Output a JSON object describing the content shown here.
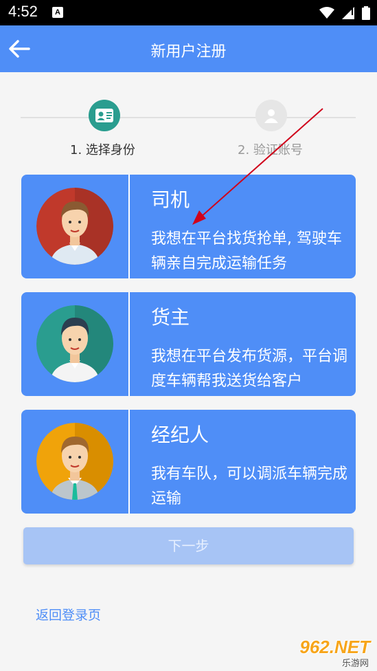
{
  "status_bar": {
    "time": "4:52",
    "notification_icon": "A"
  },
  "app_bar": {
    "title": "新用户注册",
    "back_icon": "arrow-left-icon"
  },
  "stepper": {
    "steps": [
      {
        "label": "1. 选择身份",
        "active": true,
        "icon": "id-card-icon"
      },
      {
        "label": "2. 验证账号",
        "active": false,
        "icon": "user-icon"
      }
    ]
  },
  "roles": [
    {
      "title": "司机",
      "description": "我想在平台找货抢单, 驾驶车辆亲自完成运输任务",
      "avatar_color": "#c0392b"
    },
    {
      "title": "货主",
      "description": "我想在平台发布货源，平台调度车辆帮我送货给客户",
      "avatar_color": "#2a9d8f"
    },
    {
      "title": "经纪人",
      "description": "我有车队，可以调派车辆完成运输",
      "avatar_color": "#f0a30a"
    }
  ],
  "next_button": {
    "label": "下一步"
  },
  "login_link": {
    "label": "返回登录页"
  },
  "watermark": {
    "brand": "962.NET",
    "sub": "乐游网"
  },
  "colors": {
    "primary": "#4f8ef7",
    "step_active": "#2a9d8f",
    "annotation_arrow": "#d0021b"
  }
}
